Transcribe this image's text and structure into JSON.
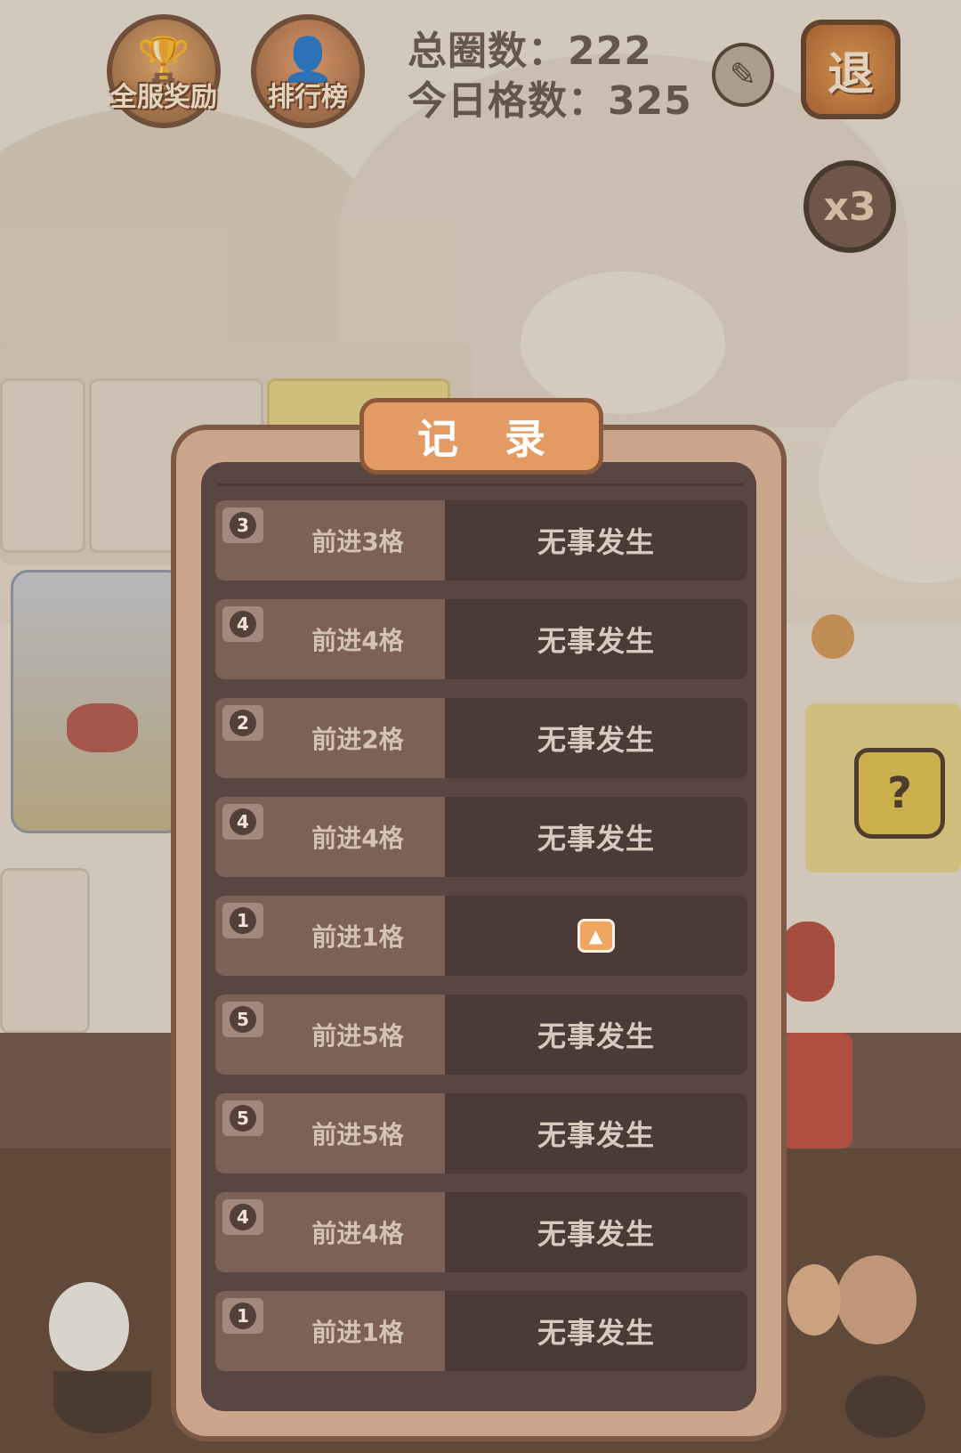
{
  "hud": {
    "reward_label": "全服奖励",
    "rank_label": "排行榜",
    "total_laps_label": "总圈数：",
    "total_laps_value": "222",
    "today_steps_label": "今日格数：",
    "today_steps_value": "325",
    "exit_label": "退",
    "speed_label": "x3"
  },
  "dialog": {
    "title": "记 录",
    "records": [
      {
        "dice": "3",
        "step": "前进3格",
        "event": "无事发生"
      },
      {
        "dice": "4",
        "step": "前进4格",
        "event": "无事发生"
      },
      {
        "dice": "2",
        "step": "前进2格",
        "event": "无事发生"
      },
      {
        "dice": "4",
        "step": "前进4格",
        "event": "无事发生"
      },
      {
        "dice": "1",
        "step": "前进1格",
        "event": "",
        "event_icon": "bowl-upgrade-icon"
      },
      {
        "dice": "5",
        "step": "前进5格",
        "event": "无事发生"
      },
      {
        "dice": "5",
        "step": "前进5格",
        "event": "无事发生"
      },
      {
        "dice": "4",
        "step": "前进4格",
        "event": "无事发生"
      },
      {
        "dice": "1",
        "step": "前进1格",
        "event": "无事发生"
      }
    ]
  },
  "colors": {
    "dialog_frame": "#cba68d",
    "dialog_inner": "#5a4640",
    "row_left": "#7c6156",
    "row_right": "#4b3a36",
    "title_plate": "#e49b63"
  }
}
